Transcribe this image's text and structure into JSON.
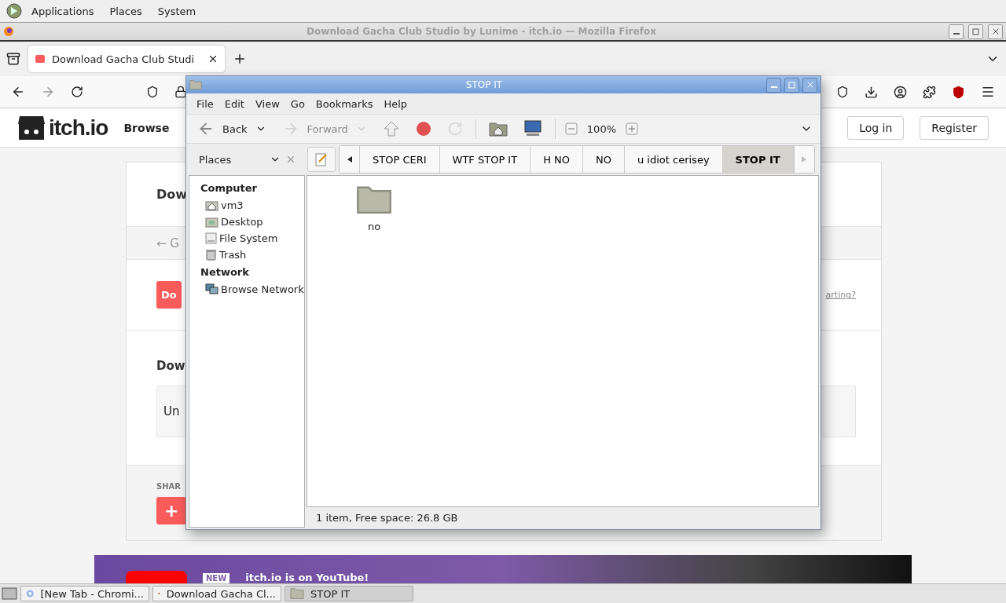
{
  "top_panel": {
    "menus": [
      "Applications",
      "Places",
      "System"
    ]
  },
  "browser": {
    "title": "Download Gacha Club Studio by Lunime - itch.io — Mozilla Firefox",
    "tabs": [
      {
        "label": "Download Gacha Club Studi",
        "selected": true
      }
    ],
    "page": {
      "logo": "itch.io",
      "nav": "Browse",
      "buttons": [
        "Log in",
        "Register"
      ],
      "heading": "Dow",
      "back_link": "← G",
      "download_button": "Do",
      "help_link": "arting?",
      "section_heading": "Dow",
      "box_text": "Un",
      "share_label": "SHAR",
      "share_button": "+",
      "banner": {
        "badge": "NEW",
        "text": "itch.io is on YouTube!"
      }
    }
  },
  "file_manager": {
    "title": "STOP IT",
    "menus": [
      "File",
      "Edit",
      "View",
      "Go",
      "Bookmarks",
      "Help"
    ],
    "toolbar": [
      {
        "kind": "back",
        "label": "Back",
        "disabled": false
      },
      {
        "kind": "forward",
        "label": "Forward",
        "disabled": true
      },
      {
        "kind": "up",
        "disabled": false
      },
      {
        "kind": "stop",
        "disabled": false
      },
      {
        "kind": "reload",
        "disabled": true
      },
      {
        "kind": "home",
        "disabled": false
      },
      {
        "kind": "computer",
        "disabled": false
      }
    ],
    "zoom": "100%",
    "sidebar": {
      "header": "Places",
      "sections": [
        {
          "title": "Computer",
          "items": [
            {
              "kind": "home",
              "label": "vm3"
            },
            {
              "kind": "desktop",
              "label": "Desktop"
            },
            {
              "kind": "drive",
              "label": "File System"
            },
            {
              "kind": "trash",
              "label": "Trash"
            }
          ]
        },
        {
          "title": "Network",
          "items": [
            {
              "kind": "network",
              "label": "Browse Network"
            }
          ]
        }
      ]
    },
    "path": [
      {
        "label": "STOP CERI",
        "selected": false
      },
      {
        "label": "WTF STOP IT",
        "selected": false
      },
      {
        "label": "H NO",
        "selected": false
      },
      {
        "label": "NO",
        "selected": false
      },
      {
        "label": "u idiot cerisey",
        "selected": false
      },
      {
        "label": "STOP IT",
        "selected": true
      }
    ],
    "files": [
      {
        "name": "no"
      }
    ],
    "status": "1 item, Free space: 26.8 GB"
  },
  "taskbar": [
    {
      "kind": "chromium",
      "label": "[New Tab - Chromi...",
      "selected": false
    },
    {
      "kind": "firefox",
      "label": "Download Gacha Cl...",
      "selected": false
    },
    {
      "kind": "folder",
      "label": "STOP IT",
      "selected": true
    }
  ]
}
